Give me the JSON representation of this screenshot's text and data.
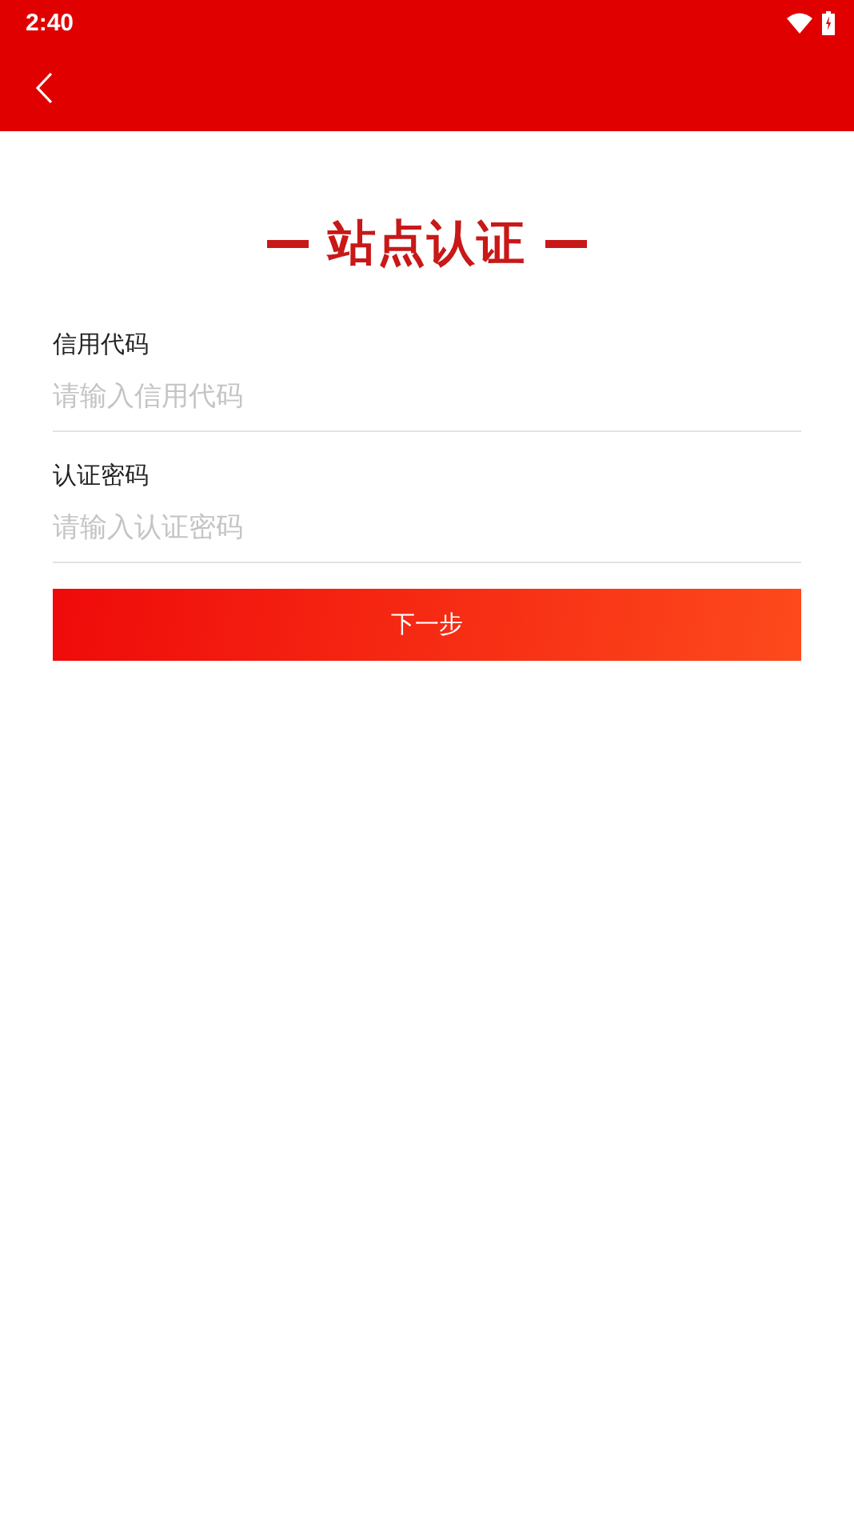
{
  "status_bar": {
    "time": "2:40"
  },
  "title": "站点认证",
  "fields": [
    {
      "label": "信用代码",
      "placeholder": "请输入信用代码"
    },
    {
      "label": "认证密码",
      "placeholder": "请输入认证密码"
    }
  ],
  "submit": {
    "label": "下一步"
  }
}
